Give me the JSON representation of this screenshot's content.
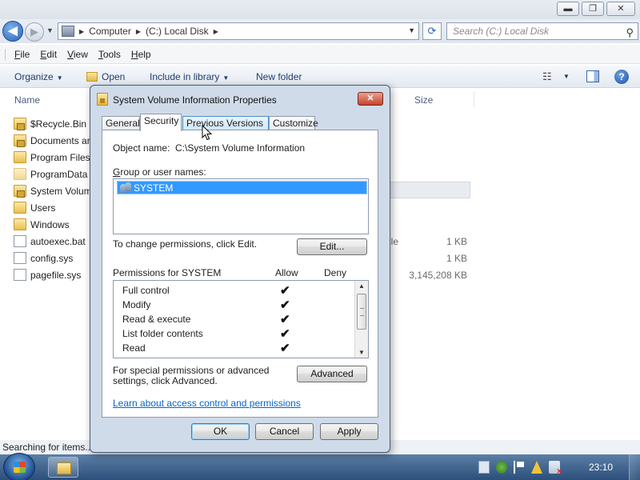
{
  "explorer": {
    "window_buttons": {
      "minimize": "▬",
      "maximize": "❐",
      "close": "✕"
    },
    "breadcrumb": [
      "Computer",
      "(C:) Local Disk"
    ],
    "search_placeholder": "Search (C:) Local Disk",
    "menu": [
      "File",
      "Edit",
      "View",
      "Tools",
      "Help"
    ],
    "toolbar": {
      "organize": "Organize",
      "open": "Open",
      "include": "Include in library",
      "new_folder": "New folder"
    },
    "columns": {
      "name": "Name",
      "size": "Size"
    },
    "files": [
      {
        "name": "$Recycle.Bin",
        "type": "",
        "size": "",
        "icon": "locked-folder-icon"
      },
      {
        "name": "Documents ar",
        "type": "",
        "size": "",
        "icon": "locked-folder-icon"
      },
      {
        "name": "Program Files",
        "type": "",
        "size": "",
        "icon": "folder-icon"
      },
      {
        "name": "ProgramData",
        "type": "",
        "size": "",
        "icon": "folder-icon"
      },
      {
        "name": "System Volum",
        "type": "",
        "size": "",
        "icon": "locked-folder-icon"
      },
      {
        "name": "Users",
        "type": "",
        "size": "",
        "icon": "folder-icon"
      },
      {
        "name": "Windows",
        "type": "",
        "size": "",
        "icon": "folder-icon"
      },
      {
        "name": "autoexec.bat",
        "type": "ile",
        "size": "1 KB",
        "icon": "batch-file-icon"
      },
      {
        "name": "config.sys",
        "type": "",
        "size": "1 KB",
        "icon": "file-icon"
      },
      {
        "name": "pagefile.sys",
        "type": "",
        "size": "3,145,208 KB",
        "icon": "file-icon"
      }
    ],
    "status": "Searching for items..."
  },
  "dialog": {
    "title": "System Volume Information Properties",
    "tabs": [
      "General",
      "Security",
      "Previous Versions",
      "Customize"
    ],
    "active_tab": "Security",
    "object_name_label": "Object name:",
    "object_name_value": "C:\\System Volume Information",
    "group_label": "Group or user names:",
    "users": [
      "SYSTEM"
    ],
    "change_text": "To change permissions, click Edit.",
    "edit_button": "Edit...",
    "permissions_label": "Permissions for SYSTEM",
    "allow_label": "Allow",
    "deny_label": "Deny",
    "permissions": [
      {
        "name": "Full control",
        "allow": "✔",
        "deny": ""
      },
      {
        "name": "Modify",
        "allow": "✔",
        "deny": ""
      },
      {
        "name": "Read & execute",
        "allow": "✔",
        "deny": ""
      },
      {
        "name": "List folder contents",
        "allow": "✔",
        "deny": ""
      },
      {
        "name": "Read",
        "allow": "✔",
        "deny": ""
      }
    ],
    "special_text": "For special permissions or advanced settings, click Advanced.",
    "advanced_button": "Advanced",
    "link": "Learn about access control and permissions",
    "ok": "OK",
    "cancel": "Cancel",
    "apply": "Apply"
  },
  "taskbar": {
    "clock": "23:10"
  }
}
